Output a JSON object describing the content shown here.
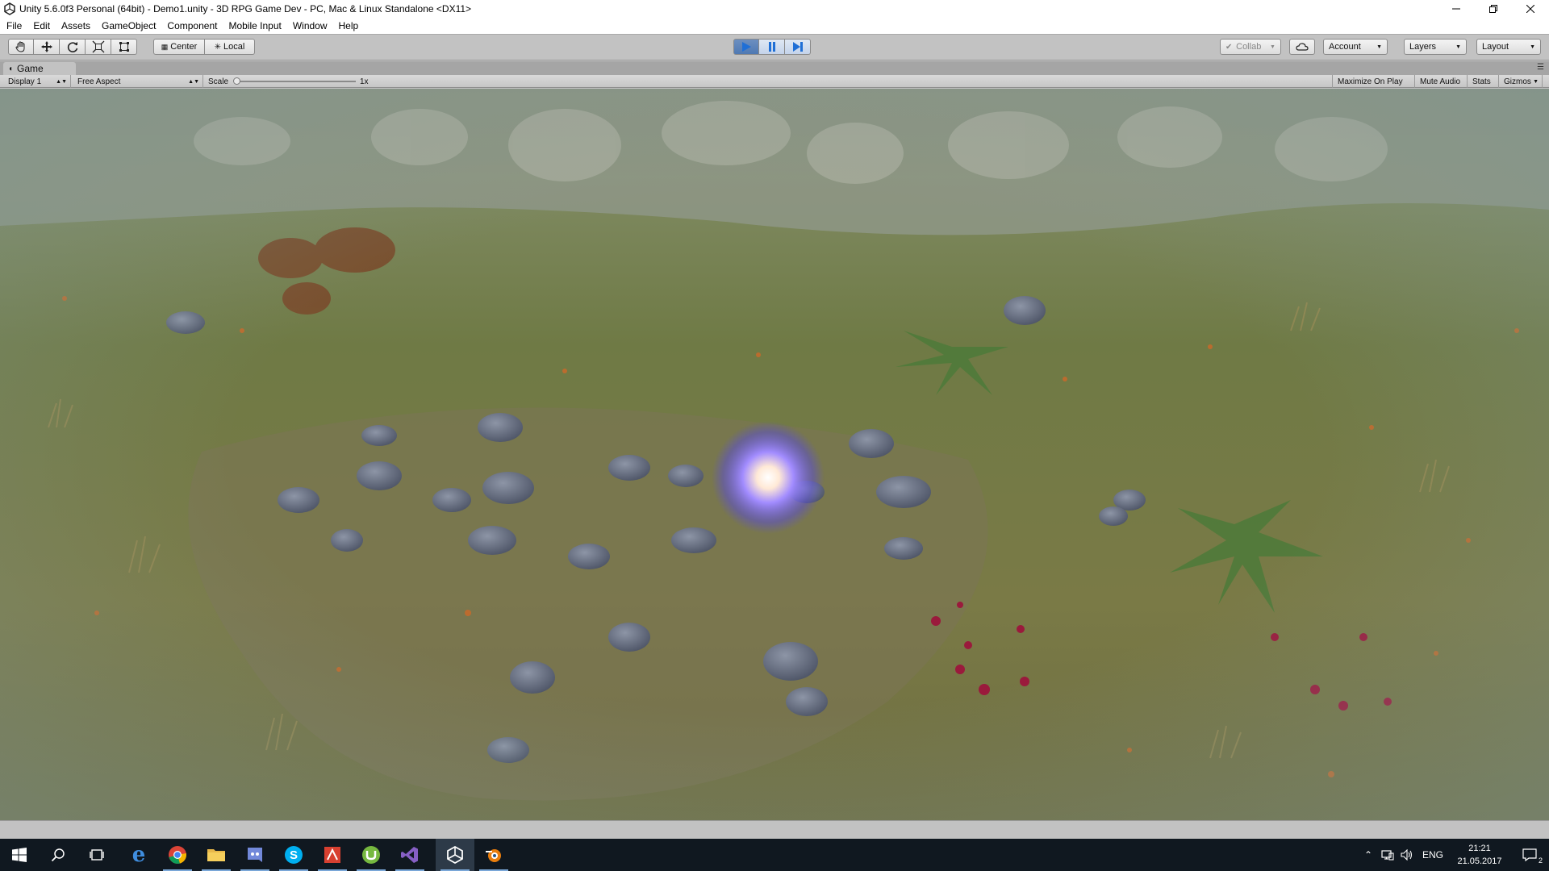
{
  "window": {
    "title": "Unity 5.6.0f3 Personal (64bit) - Demo1.unity - 3D RPG Game Dev - PC, Mac & Linux Standalone <DX11>"
  },
  "menu": {
    "items": [
      "File",
      "Edit",
      "Assets",
      "GameObject",
      "Component",
      "Mobile Input",
      "Window",
      "Help"
    ]
  },
  "toolbar": {
    "tools": [
      "hand-tool-icon",
      "move-tool-icon",
      "rotate-tool-icon",
      "scale-tool-icon",
      "rect-tool-icon"
    ],
    "pivot_label": "Center",
    "space_label": "Local",
    "play_state": "playing",
    "collab_label": "Collab",
    "account_label": "Account",
    "layers_label": "Layers",
    "layout_label": "Layout"
  },
  "game_panel": {
    "tab_label": "Game",
    "display_label": "Display 1",
    "aspect_label": "Free Aspect",
    "scale_label": "Scale",
    "scale_value": "1x",
    "scale_fraction": 0.0,
    "maximize_label": "Maximize On Play",
    "mute_label": "Mute Audio",
    "stats_label": "Stats",
    "gizmos_label": "Gizmos"
  },
  "taskbar": {
    "apps": [
      "windows-start-icon",
      "search-icon",
      "task-view-icon",
      "edge-icon",
      "chrome-icon",
      "file-explorer-icon",
      "discord-icon",
      "skype-icon",
      "app-red-icon",
      "utorrent-icon",
      "visual-studio-icon",
      "unity-icon",
      "app-blender-icon"
    ],
    "language": "ENG",
    "time": "21:21",
    "date": "21.05.2017",
    "notification_count": "2"
  },
  "colors": {
    "play_active": "#4f79b3",
    "taskbar_bg": "#101820",
    "editor_gray": "#c2c2c2"
  }
}
